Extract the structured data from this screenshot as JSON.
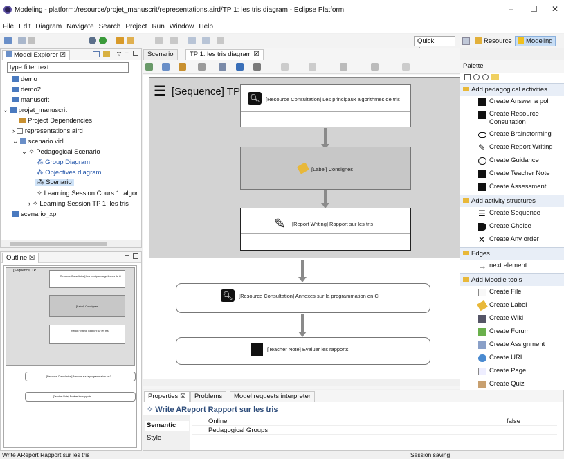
{
  "window": {
    "title": "Modeling - platform:/resource/projet_manuscrit/representations.aird/TP 1: les tris diagram - Eclipse Platform",
    "minimize": "–",
    "maximize": "☐",
    "close": "✕"
  },
  "menu": [
    "File",
    "Edit",
    "Diagram",
    "Navigate",
    "Search",
    "Project",
    "Run",
    "Window",
    "Help"
  ],
  "toolbar": {
    "quick_access": "Quick Access",
    "perspective_resource": "Resource",
    "perspective_modeling": "Modeling"
  },
  "explorer": {
    "tab": "Model Explorer",
    "filter_placeholder": "type filter text",
    "items": [
      "demo",
      "demo2",
      "manuscrit",
      "projet_manuscrit",
      "Project Dependencies",
      "representations.aird",
      "scenario.vidl",
      "Pedagogical Scenario",
      "Group Diagram",
      "Objectives diagram",
      "Scenario",
      "Learning Session Cours 1: algor",
      "Learning Session TP 1: les tris",
      "scenario_xp"
    ]
  },
  "editor_tabs": [
    "Scenario",
    "TP 1: les tris diagram"
  ],
  "diagram": {
    "sequence_title": "[Sequence] TP",
    "n1": "[Resource Consultation] Les principaux algorithmes de tris",
    "n2": "[Label] Consignes",
    "n3": "[Report Writing] Rapport sur les tris",
    "n4": "[Resource Consultation] Annexes sur la programmation en C",
    "n5": "[Teacher Note] Evaluer les rapports"
  },
  "palette": {
    "title": "Palette",
    "drawers": [
      "Add pedagogical activities",
      "Add activity structures",
      "Edges",
      "Add Moodle tools"
    ],
    "pedagogical": [
      "Create Answer a poll",
      "Create Resource Consultation",
      "Create Brainstorming",
      "Create Report Writing",
      "Create Guidance",
      "Create Teacher Note",
      "Create Assessment"
    ],
    "structures": [
      "Create Sequence",
      "Create Choice",
      "Create Any order"
    ],
    "edges": [
      "next element"
    ],
    "moodle": [
      "Create File",
      "Create Label",
      "Create Wiki",
      "Create Forum",
      "Create Assignment",
      "Create URL",
      "Create Page",
      "Create Quiz"
    ]
  },
  "outline": {
    "tab": "Outline",
    "labels": [
      "[Sequence] TP",
      "[Resource Consultation] Les principaux algorithmes de tri",
      "[Label] Consignes",
      "[Report Writing] Rapport sur les tris",
      "[Resource Consultation] Annexes sur la programmation en C",
      "[Teacher Note] Evaluer les rapports"
    ]
  },
  "bottom": {
    "tabs": [
      "Properties",
      "Problems",
      "Model requests interpreter"
    ],
    "header": "Write AReport  Rapport sur les tris",
    "side_tabs": [
      "Semantic",
      "Style"
    ],
    "rows": [
      {
        "k": "Online",
        "v": "false"
      },
      {
        "k": "Pedagogical Groups",
        "v": ""
      }
    ]
  },
  "status": {
    "left": "Write AReport  Rapport sur les tris",
    "right": "Session saving"
  },
  "colors": {
    "palette_drawer": "#e8eef7",
    "sequence_bg": "#d3d3d3",
    "arrow": "#8a8a8a",
    "selection": "#c7ddf5"
  }
}
